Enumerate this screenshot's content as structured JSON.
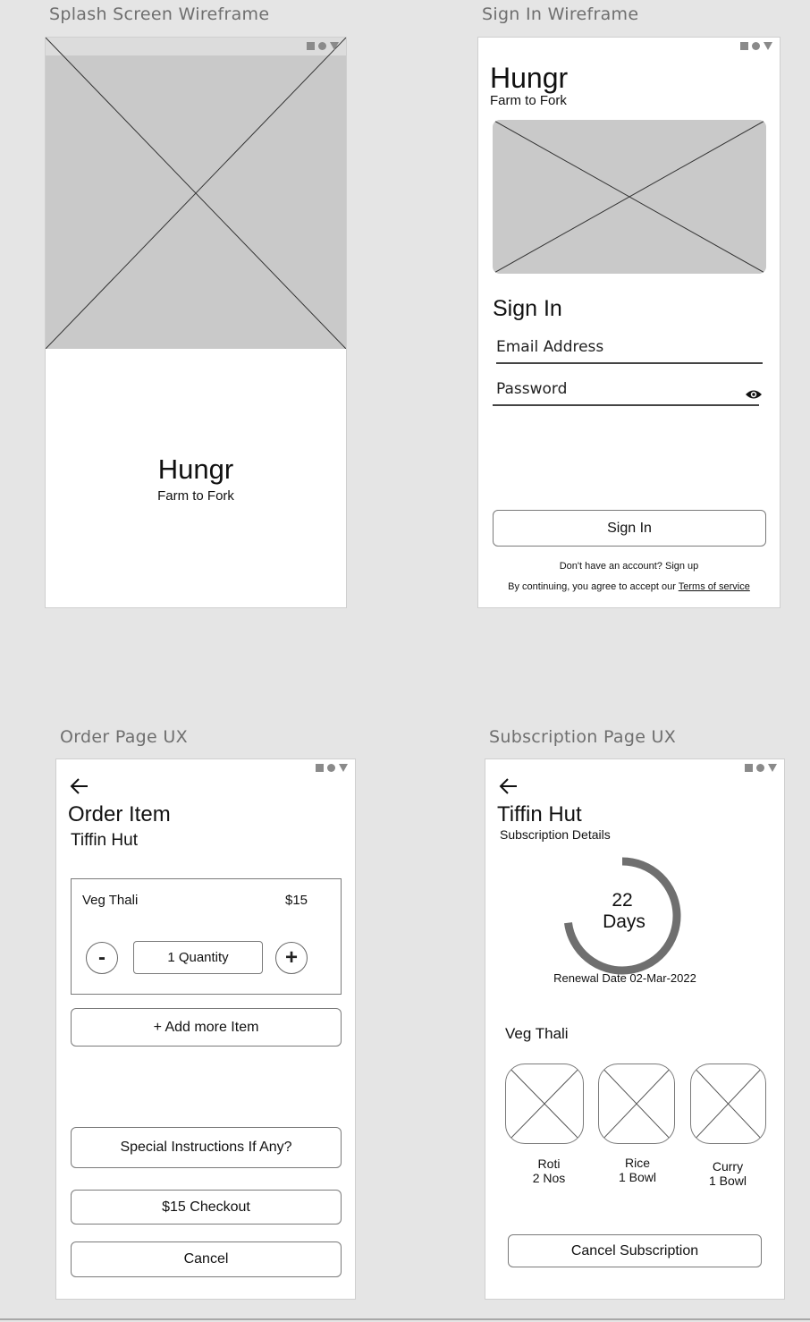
{
  "splash": {
    "board_title": "Splash Screen Wireframe",
    "app_name": "Hungr",
    "tagline": "Farm to Fork"
  },
  "signin": {
    "board_title": "Sign In Wireframe",
    "app_name": "Hungr",
    "tagline": "Farm to Fork",
    "heading": "Sign In",
    "email_label": "Email Address",
    "password_label": "Password",
    "signin_button": "Sign In",
    "signup_prompt": "Don't have an account? Sign up",
    "terms_prefix": "By continuing, you agree to accept our ",
    "terms_link": "Terms of service"
  },
  "order": {
    "board_title": "Order Page UX",
    "heading": "Order Item",
    "restaurant": "Tiffin Hut",
    "item_name": "Veg Thali",
    "item_price": "$15",
    "minus_label": "-",
    "quantity": "1 Quantity",
    "plus_label": "+",
    "add_more": "+ Add more Item",
    "special_instructions": "Special Instructions If Any?",
    "checkout": "$15 Checkout",
    "cancel": "Cancel"
  },
  "subscription": {
    "board_title": "Subscription Page UX",
    "restaurant": "Tiffin Hut",
    "subtitle": "Subscription Details",
    "days_count": "22",
    "days_unit": "Days",
    "renewal": "Renewal Date 02-Mar-2022",
    "plan_name": "Veg Thali",
    "items": [
      {
        "name": "Roti",
        "qty": "2 Nos"
      },
      {
        "name": "Rice",
        "qty": "1 Bowl"
      },
      {
        "name": "Curry",
        "qty": "1 Bowl"
      }
    ],
    "progress_fraction": 0.73,
    "cancel_button": "Cancel Subscription"
  },
  "colors": {
    "background": "#e5e5e5",
    "placeholder": "#c9c9c9",
    "ring": "#6f6f6f"
  }
}
